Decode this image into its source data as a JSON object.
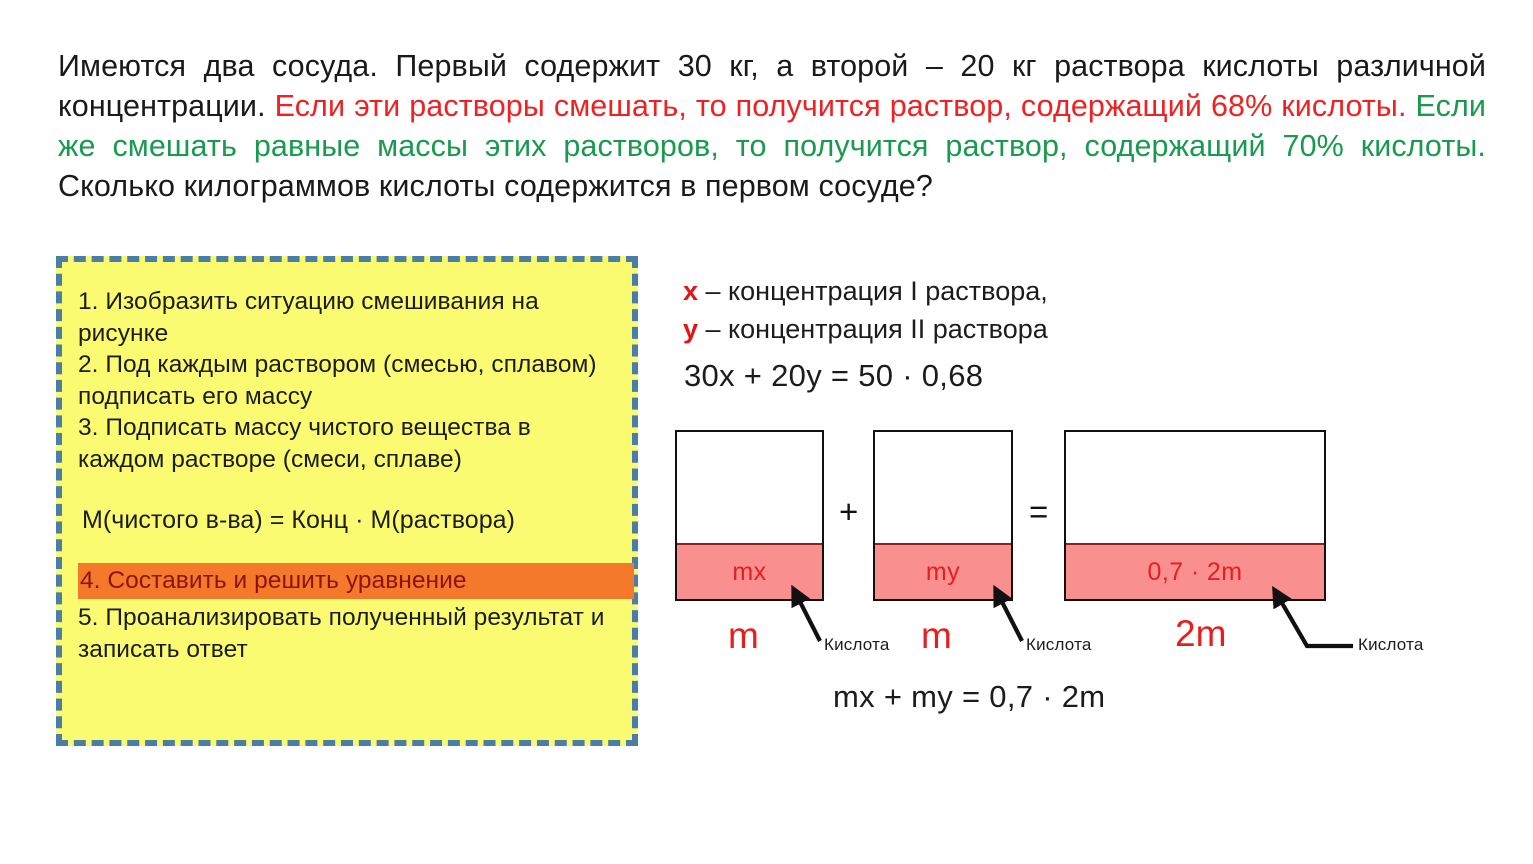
{
  "problem": {
    "segments": [
      {
        "text": "Имеются два сосуда. Первый содержит 30 кг, а второй – 20 кг раствора кислоты различной концентрации. ",
        "color": "black"
      },
      {
        "text": "Если эти растворы смешать, то получится раствор, содержащий 68% кислоты. ",
        "color": "red"
      },
      {
        "text": "Если же смешать равные массы этих растворов, то получится раствор, содержащий 70% кислоты. ",
        "color": "green"
      },
      {
        "text": "Сколько килограммов кислоты содержится в первом сосуде?",
        "color": "black"
      }
    ],
    "full_text": "Имеются два сосуда. Первый содержит 30 кг, а второй – 20 кг раствора кислоты различной концентрации. Если эти растворы смешать, то получится раствор, содержащий 68% кислоты. Если же смешать равные массы этих растворов, то получится раствор, содержащий 70% кислоты. Сколько килограммов кислоты содержится в первом сосуде?"
  },
  "steps_box": {
    "step1": "1. Изобразить ситуацию смешивания на рисунке",
    "step2": "2. Под каждым раствором (смесью, сплавом) подписать его массу",
    "step3": "3. Подписать массу чистого вещества в каждом растворе (смеси, сплаве)",
    "formula": "M(чистого в-ва) = Конц · M(раствора)",
    "step4": "4. Составить и решить уравнение",
    "step5": "5. Проанализировать полученный результат и записать ответ"
  },
  "solution": {
    "var_x_name": "x",
    "var_x_desc": " – концентрация I раствора,",
    "var_y_name": "y",
    "var_y_desc": " – концентрация II раствора",
    "equation_top": "30x + 20y = 50 · 0,68",
    "equation_bottom": "mx + my = 0,7 · 2m"
  },
  "diagram": {
    "vessels": [
      {
        "fill_label": "mx",
        "mass_label": "m",
        "acid_label": "Кислота"
      },
      {
        "fill_label": "my",
        "mass_label": "m",
        "acid_label": "Кислота"
      },
      {
        "fill_label": "0,7 · 2m",
        "mass_label": "2m",
        "acid_label": "Кислота"
      }
    ],
    "operator_plus": "+",
    "operator_equal": "="
  },
  "colors": {
    "red_text": "#ee2222",
    "green_text": "#1a9a4e",
    "box_background": "#fbfb72",
    "box_border": "#4a7ea6",
    "highlight_orange": "#f4792b",
    "highlight_text": "#8e1212",
    "acid_fill": "#f98f8f",
    "variable_red": "#e31414"
  }
}
